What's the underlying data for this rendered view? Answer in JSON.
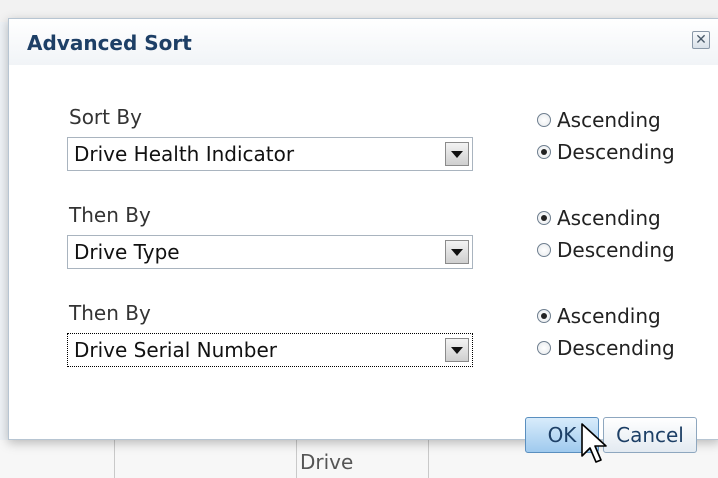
{
  "dialog": {
    "title": "Advanced Sort",
    "close_label": "✕"
  },
  "sort_rows": [
    {
      "label": "Sort By",
      "selected": "Drive Health Indicator",
      "order": "Descending",
      "ascending_label": "Ascending",
      "descending_label": "Descending"
    },
    {
      "label": "Then By",
      "selected": "Drive Type",
      "order": "Ascending",
      "ascending_label": "Ascending",
      "descending_label": "Descending"
    },
    {
      "label": "Then By",
      "selected": "Drive Serial Number",
      "order": "Ascending",
      "ascending_label": "Ascending",
      "descending_label": "Descending"
    }
  ],
  "buttons": {
    "ok": "OK",
    "cancel": "Cancel"
  },
  "background": {
    "column_header_fragment": "Drive"
  },
  "colors": {
    "title": "#1d3f66",
    "ok_hover": "#9fcaee"
  }
}
